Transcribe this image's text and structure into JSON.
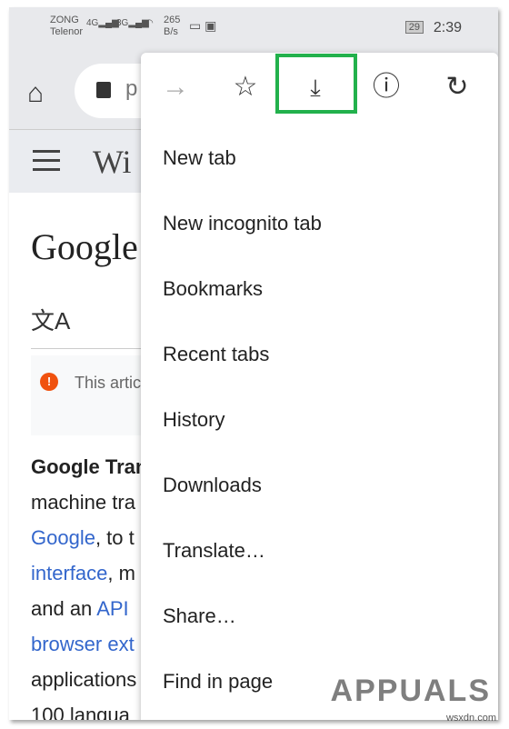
{
  "status": {
    "carrier1": "ZONG",
    "carrier2": "Telenor",
    "net1": "4G",
    "net2": "3G",
    "speed": "265",
    "speed_unit": "B/s",
    "battery": "29",
    "time": "2:39"
  },
  "toolbar": {
    "url_partial": "p"
  },
  "wiki": {
    "logo_partial": "Wi",
    "title_partial": "Google",
    "notice_partial": "This artic"
  },
  "paragraph": [
    "Google Tran",
    "machine tra",
    "Google",
    ", to t",
    "interface",
    ", m",
    "and an ",
    "API",
    "browser ext",
    "applications",
    "100 langua"
  ],
  "menu": {
    "icons": [
      "forward-icon",
      "bookmark-star-icon",
      "download-icon",
      "info-icon",
      "reload-icon"
    ],
    "highlight_color": "#22b14c",
    "items": [
      "New tab",
      "New incognito tab",
      "Bookmarks",
      "Recent tabs",
      "History",
      "Downloads",
      "Translate…",
      "Share…",
      "Find in page"
    ]
  },
  "watermark": {
    "brand": "APPUALS",
    "site": "wsxdn.com"
  }
}
